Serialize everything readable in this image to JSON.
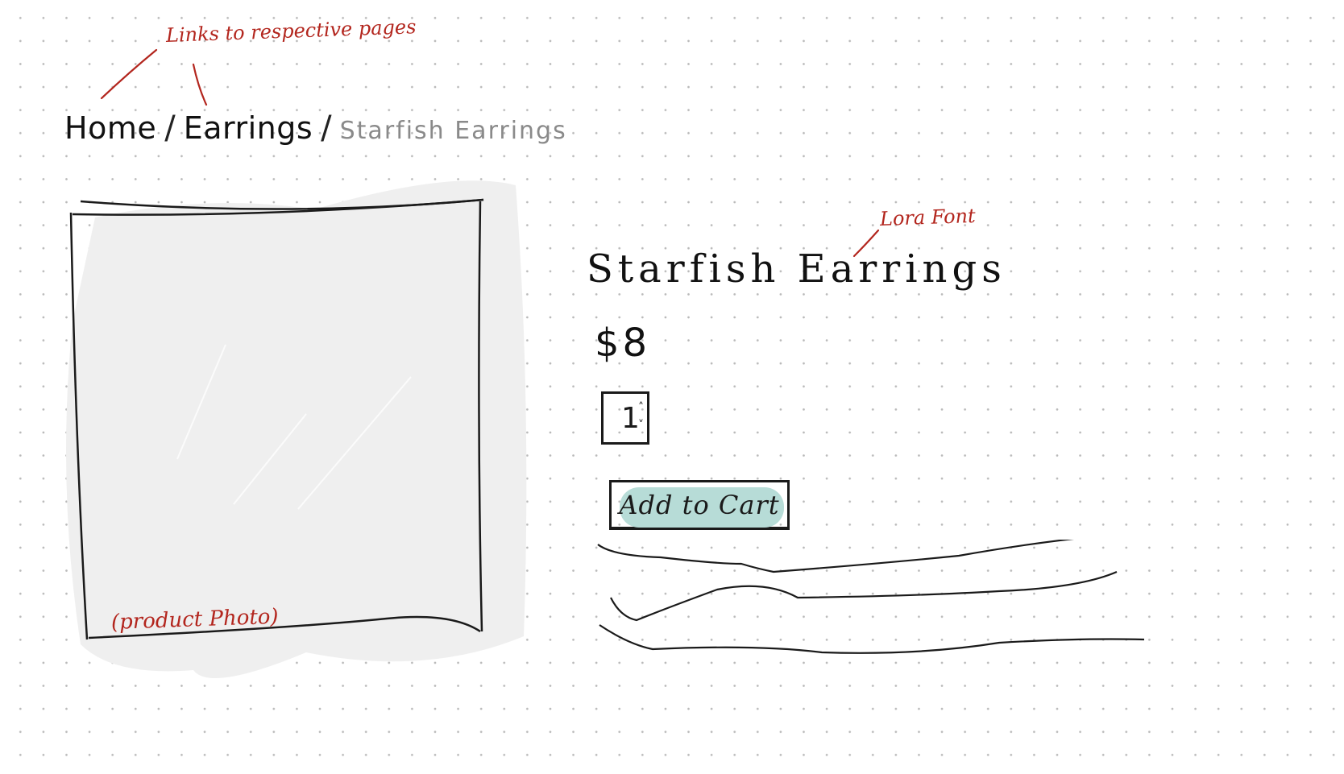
{
  "annotations": {
    "links_note": "Links to respective pages",
    "font_note": "Lora Font",
    "photo_note": "(product Photo)"
  },
  "breadcrumb": {
    "home": "Home",
    "category": "Earrings",
    "current": "Starfish Earrings",
    "separator": "/"
  },
  "product": {
    "name": "Starfish Earrings",
    "price": "$8",
    "quantity": "1",
    "add_to_cart_label": "Add to Cart"
  },
  "colors": {
    "annotation": "#b3261e",
    "button_highlight": "#b7dcd7",
    "photo_fill": "#efefef"
  },
  "icons": {
    "quantity_up": "chevron-up-icon",
    "quantity_down": "chevron-down-icon"
  }
}
